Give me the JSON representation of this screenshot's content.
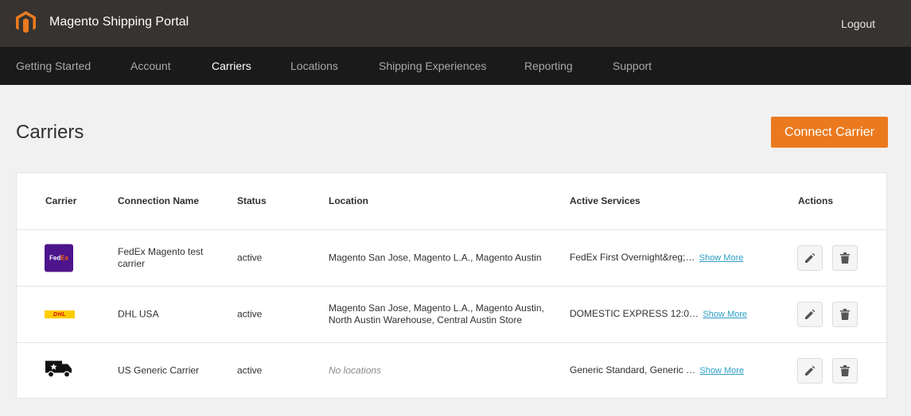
{
  "app": {
    "title": "Magento Shipping Portal",
    "logout_label": "Logout",
    "brand_color": "#eb7a1f"
  },
  "nav": {
    "items": [
      {
        "label": "Getting Started"
      },
      {
        "label": "Account"
      },
      {
        "label": "Carriers",
        "active": true
      },
      {
        "label": "Locations"
      },
      {
        "label": "Shipping Experiences"
      },
      {
        "label": "Reporting"
      },
      {
        "label": "Support"
      }
    ]
  },
  "page": {
    "title": "Carriers",
    "connect_button": "Connect Carrier"
  },
  "table": {
    "headers": {
      "carrier": "Carrier",
      "connection_name": "Connection Name",
      "status": "Status",
      "location": "Location",
      "active_services": "Active Services",
      "actions": "Actions"
    },
    "show_more_label": "Show More",
    "rows": [
      {
        "carrier_logo": "FedEx",
        "connection_name": "FedEx Magento test carrier",
        "status": "active",
        "location": "Magento San Jose, Magento L.A., Magento Austin",
        "active_services": "FedEx First Overnight&reg;…"
      },
      {
        "carrier_logo": "DHL",
        "connection_name": "DHL USA",
        "status": "active",
        "location": "Magento San Jose, Magento L.A., Magento Austin, North Austin Warehouse, Central Austin Store",
        "active_services": "DOMESTIC EXPRESS 12:0…"
      },
      {
        "carrier_logo": "generic-truck-icon",
        "connection_name": "US Generic Carrier",
        "status": "active",
        "location": "No locations",
        "active_services": "Generic Standard, Generic …"
      }
    ]
  }
}
